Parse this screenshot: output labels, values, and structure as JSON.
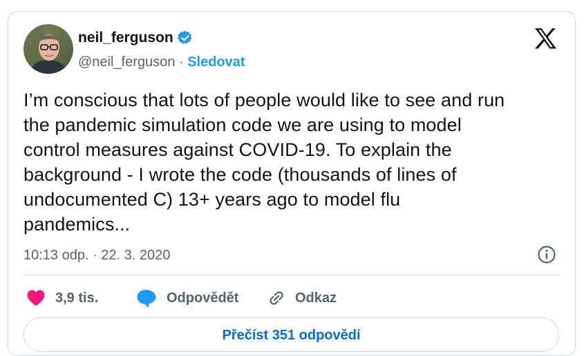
{
  "author": {
    "display_name": "neil_ferguson",
    "handle": "@neil_ferguson",
    "separator": " · ",
    "follow_label": "Sledovat",
    "verified_icon": "verified-badge-icon",
    "verified_color": "#1d9bf0"
  },
  "header": {
    "logo_icon": "x-logo-icon"
  },
  "tweet": {
    "text": "I’m conscious that lots of people would like to see and run\nthe pandemic simulation code we are using to model\ncontrol measures against COVID-19.  To explain the\nbackground - I wrote the code (thousands of lines of\nundocumented C) 13+ years ago to model flu\npandemics...",
    "timestamp": "10:13 odp. · 22. 3. 2020",
    "info_icon": "info-icon"
  },
  "actions": {
    "like": {
      "icon": "heart-icon",
      "count": "3,9 tis.",
      "color": "#f91880"
    },
    "reply": {
      "icon": "reply-bubble-icon",
      "label": "Odpovědět",
      "color": "#1d9bf0"
    },
    "link": {
      "icon": "link-icon",
      "label": "Odkaz"
    }
  },
  "read_replies": {
    "label": "Přečíst 351 odpovědí",
    "color": "#006fd6"
  }
}
